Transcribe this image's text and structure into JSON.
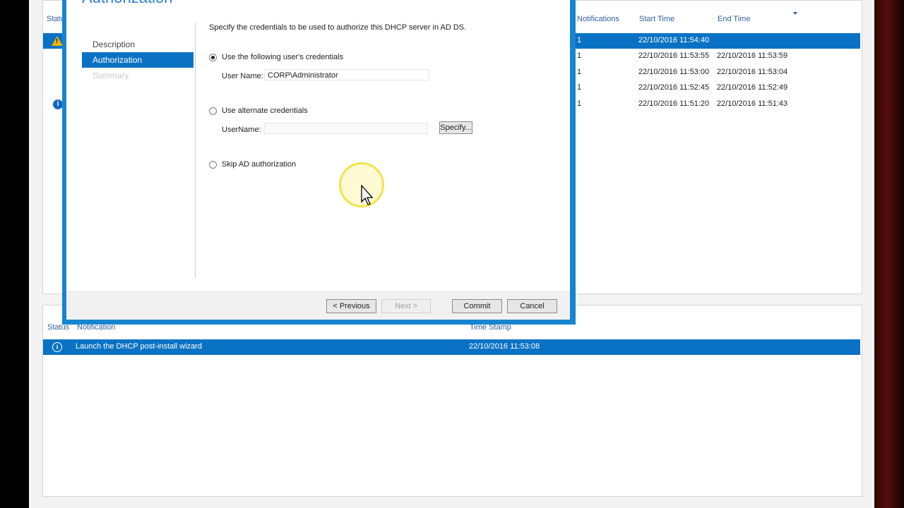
{
  "dialog": {
    "title": "Authorization",
    "nav": [
      {
        "label": "Description",
        "state": "normal"
      },
      {
        "label": "Authorization",
        "state": "active"
      },
      {
        "label": "Summary",
        "state": "disabled"
      }
    ],
    "intro": "Specify the credentials to be used to authorize this DHCP server in AD DS.",
    "option_user_creds": "Use the following user's credentials",
    "user_name_label": "User Name:",
    "user_name_value": "CORP\\Administrator",
    "option_alt_creds": "Use alternate credentials",
    "alt_user_name_label": "UserName:",
    "alt_user_name_value": "",
    "specify_label": "Specify...",
    "option_skip": "Skip AD authorization",
    "buttons": {
      "previous": "< Previous",
      "next": "Next >",
      "commit": "Commit",
      "cancel": "Cancel"
    }
  },
  "tasks": {
    "headers": {
      "status": "Status",
      "notifications": "Notifications",
      "start_time": "Start Time",
      "end_time": "End Time"
    },
    "rows": [
      {
        "count": "1",
        "start": "22/10/2016 11:54:40",
        "end": ""
      },
      {
        "count": "1",
        "start": "22/10/2016 11:53:55",
        "end": "22/10/2016 11:53:59"
      },
      {
        "count": "1",
        "start": "22/10/2016 11:53:00",
        "end": "22/10/2016 11:53:04"
      },
      {
        "count": "1",
        "start": "22/10/2016 11:52:45",
        "end": "22/10/2016 11:52:49"
      },
      {
        "count": "1",
        "start": "22/10/2016 11:51:20",
        "end": "22/10/2016 11:51:43"
      }
    ]
  },
  "notifications": {
    "headers": {
      "status": "Status",
      "notification": "Notification",
      "time_stamp": "Time Stamp"
    },
    "rows": [
      {
        "text": "Launch the DHCP post-install wizard",
        "time": "22/10/2016 11:53:08"
      }
    ]
  },
  "colors": {
    "accent": "#0a72c4",
    "dialog_border": "#1784d0",
    "header_text": "#2f5f9e",
    "warning": "#f0b400"
  }
}
